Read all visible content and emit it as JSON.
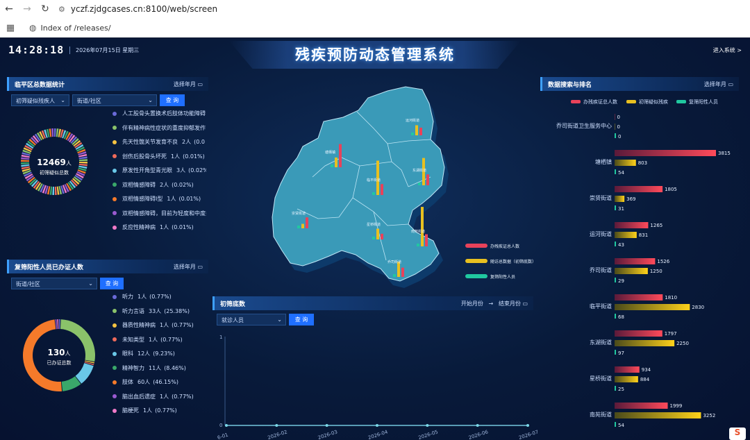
{
  "browser": {
    "url": "yczf.zjdgcases.cn:8100/web/screen",
    "bookmark": "Index of /releases/"
  },
  "header": {
    "time": "14:28:18",
    "date": "2026年07月15日 星期三",
    "title": "残疾预防动态管理系统",
    "enter": "进入系统 >"
  },
  "panel1": {
    "title": "临平区总数据统计",
    "month_label": "选择年月",
    "filter1": "初筛疑似残疾人",
    "filter2": "街道/社区",
    "query": "查 询",
    "total": "12469",
    "unit": "人",
    "sub": "初筛疑似总数",
    "items": [
      {
        "label": "人工股骨头置换术后肢体功能障碍",
        "count": "",
        "pct": "",
        "color": "#6a6ad8"
      },
      {
        "label": "伴有精神病性症状的重度抑郁发作",
        "count": "",
        "pct": "",
        "color": "#8ac26a"
      },
      {
        "label": "先天性髋关节发育不良",
        "count": "2人",
        "pct": "(0.0",
        "color": "#f5c342"
      },
      {
        "label": "创伤后股骨头坏死",
        "count": "1人",
        "pct": "(0.01%)",
        "color": "#ee6a5a"
      },
      {
        "label": "原发性开角型青光眼",
        "count": "3人",
        "pct": "(0.02%",
        "color": "#6ac8e8"
      },
      {
        "label": "双相情感障碍",
        "count": "2人",
        "pct": "(0.02%)",
        "color": "#3aa86a"
      },
      {
        "label": "双相情感障碍Ⅰ型",
        "count": "1人",
        "pct": "(0.01%)",
        "color": "#f57a2a"
      },
      {
        "label": "双相情感障碍，目前为轻度和中度抑",
        "count": "",
        "pct": "",
        "color": "#9a5ad0"
      },
      {
        "label": "反应性精神病",
        "count": "1人",
        "pct": "(0.01%)",
        "color": "#f07ac8"
      }
    ]
  },
  "panel2": {
    "title": "复筛阳性人员已办证人数",
    "month_label": "选择年月",
    "filter": "街道/社区",
    "query": "查 询",
    "total": "130",
    "unit": "人",
    "sub": "已办证总数",
    "items": [
      {
        "label": "听力",
        "count": "1人",
        "pct": "(0.77%)",
        "color": "#6a6ad8",
        "value": 1
      },
      {
        "label": "听力言语",
        "count": "33人",
        "pct": "(25.38%)",
        "color": "#8ac26a",
        "value": 33
      },
      {
        "label": "器质性精神病",
        "count": "1人",
        "pct": "(0.77%)",
        "color": "#f5c342",
        "value": 1
      },
      {
        "label": "未知类型",
        "count": "1人",
        "pct": "(0.77%)",
        "color": "#ee6a5a",
        "value": 1
      },
      {
        "label": "眼科",
        "count": "12人",
        "pct": "(9.23%)",
        "color": "#6ac8e8",
        "value": 12
      },
      {
        "label": "精神智力",
        "count": "11人",
        "pct": "(8.46%)",
        "color": "#3aa86a",
        "value": 11
      },
      {
        "label": "肢体",
        "count": "60人",
        "pct": "(46.15%)",
        "color": "#f57a2a",
        "value": 60
      },
      {
        "label": "脑出血后遗症",
        "count": "1人",
        "pct": "(0.77%)",
        "color": "#9a5ad0",
        "value": 1
      },
      {
        "label": "脑梗死",
        "count": "1人",
        "pct": "(0.77%)",
        "color": "#f07ac8",
        "value": 1
      }
    ]
  },
  "map": {
    "regions": [
      "运河街道",
      "塘栖镇",
      "临平街道",
      "东湖街道",
      "崇贤街道",
      "星桥街道",
      "南苑街道",
      "乔司街道"
    ],
    "legend": [
      "办残疾证总人数",
      "随访总数据（初筛底数）",
      "复筛阳性人员"
    ]
  },
  "panel3": {
    "title": "初筛底数",
    "start": "开始月份",
    "arrow": "→",
    "end": "结束月份",
    "filter": "就诊人员",
    "query": "查 询",
    "chart_data": {
      "type": "line",
      "x": [
        "6-01",
        "2026-02",
        "2026-03",
        "2026-04",
        "2026-05",
        "2026-06",
        "2026-07"
      ],
      "y_ticks": [
        "1",
        "0"
      ],
      "values": [
        0,
        0,
        0,
        0,
        0,
        0,
        0
      ],
      "ylim": [
        0,
        1
      ]
    }
  },
  "panel4": {
    "title": "数据搜索与排名",
    "month_label": "选择年月",
    "legend": [
      "办残疾证总人数",
      "初筛疑似残疾",
      "复筛阳性人员"
    ],
    "colors": [
      "#e8425a",
      "#e8c020",
      "#20c8a0"
    ],
    "chart_data": {
      "type": "bar",
      "categories": [
        "乔司街道卫生服务中心",
        "塘栖镇",
        "崇贤街道",
        "运河街道",
        "乔司街道",
        "临平街道",
        "东湖街道",
        "星桥街道",
        "南苑街道"
      ],
      "series": [
        {
          "name": "办残疾证总人数",
          "values": [
            0,
            3815,
            1805,
            1265,
            1526,
            1810,
            1797,
            934,
            1999
          ]
        },
        {
          "name": "初筛疑似残疾",
          "values": [
            0,
            803,
            369,
            831,
            1250,
            2830,
            2250,
            884,
            3252
          ]
        },
        {
          "name": "复筛阳性人员",
          "values": [
            0,
            54,
            31,
            43,
            29,
            68,
            97,
            25,
            54
          ]
        }
      ],
      "labels": [
        [
          "0",
          "0",
          "0"
        ],
        [
          "3815",
          "803",
          "54"
        ],
        [
          "1805",
          "369",
          "31"
        ],
        [
          "1265",
          "831",
          "43"
        ],
        [
          "1526",
          "1250",
          "29"
        ],
        [
          "1810",
          "2830",
          "68"
        ],
        [
          "1797",
          "2250",
          "97"
        ],
        [
          "934",
          "884",
          "25"
        ],
        [
          "1999",
          "3252",
          "54"
        ]
      ]
    }
  }
}
